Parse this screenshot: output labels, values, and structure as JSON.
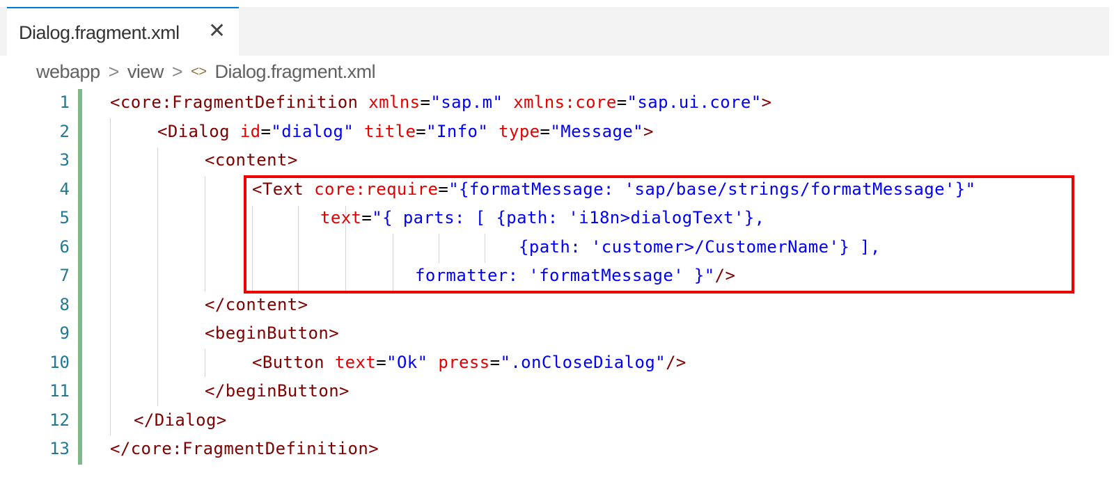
{
  "tab": {
    "title": "Dialog.fragment.xml",
    "close_icon": "close-icon"
  },
  "breadcrumb": {
    "items": [
      "webapp",
      "view"
    ],
    "separator": ">",
    "file_icon": "xml-code-icon",
    "file": "Dialog.fragment.xml"
  },
  "colors": {
    "tag": "#800000",
    "attribute": "#e50000",
    "value": "#0000ff",
    "line_number": "#237893",
    "highlight": "#ee0000",
    "git_bar": "#81b88b"
  },
  "line_numbers": [
    "1",
    "2",
    "3",
    "4",
    "5",
    "6",
    "7",
    "8",
    "9",
    "10",
    "11",
    "12",
    "13"
  ],
  "code": {
    "l1": {
      "open": "<",
      "tag": "core:FragmentDefinition",
      "a1": "xmlns",
      "eq1": "=",
      "v1": "\"sap.m\"",
      "a2": "xmlns:core",
      "eq2": "=",
      "v2": "\"sap.ui.core\"",
      "close": ">"
    },
    "l2": {
      "open": "<",
      "tag": "Dialog",
      "a1": "id",
      "eq1": "=",
      "v1": "\"dialog\"",
      "a2": "title",
      "eq2": "=",
      "v2": "\"Info\"",
      "a3": "type",
      "eq3": "=",
      "v3": "\"Message\"",
      "close": ">"
    },
    "l3": {
      "open": "<",
      "tag": "content",
      "close": ">"
    },
    "l4": {
      "open": "<",
      "tag": "Text",
      "a1": "core:require",
      "eq1": "=",
      "v1": "\"{formatMessage: 'sap/base/strings/formatMessage'}\""
    },
    "l5": {
      "a1": "text",
      "eq1": "=",
      "v1": "\"{ parts: [ {path: 'i18n>dialogText'},"
    },
    "l6": {
      "v1": "{path: 'customer>/CustomerName'} ],"
    },
    "l7": {
      "v1": "formatter: 'formatMessage' }\"",
      "close": "/>"
    },
    "l8": {
      "open": "</",
      "tag": "content",
      "close": ">"
    },
    "l9": {
      "open": "<",
      "tag": "beginButton",
      "close": ">"
    },
    "l10": {
      "open": "<",
      "tag": "Button",
      "a1": "text",
      "eq1": "=",
      "v1": "\"Ok\"",
      "a2": "press",
      "eq2": "=",
      "v2": "\".onCloseDialog\"",
      "close": "/>"
    },
    "l11": {
      "open": "</",
      "tag": "beginButton",
      "close": ">"
    },
    "l12": {
      "open": "</",
      "tag": "Dialog",
      "close": ">"
    },
    "l13": {
      "open": "</",
      "tag": "core:FragmentDefinition",
      "close": ">"
    }
  }
}
